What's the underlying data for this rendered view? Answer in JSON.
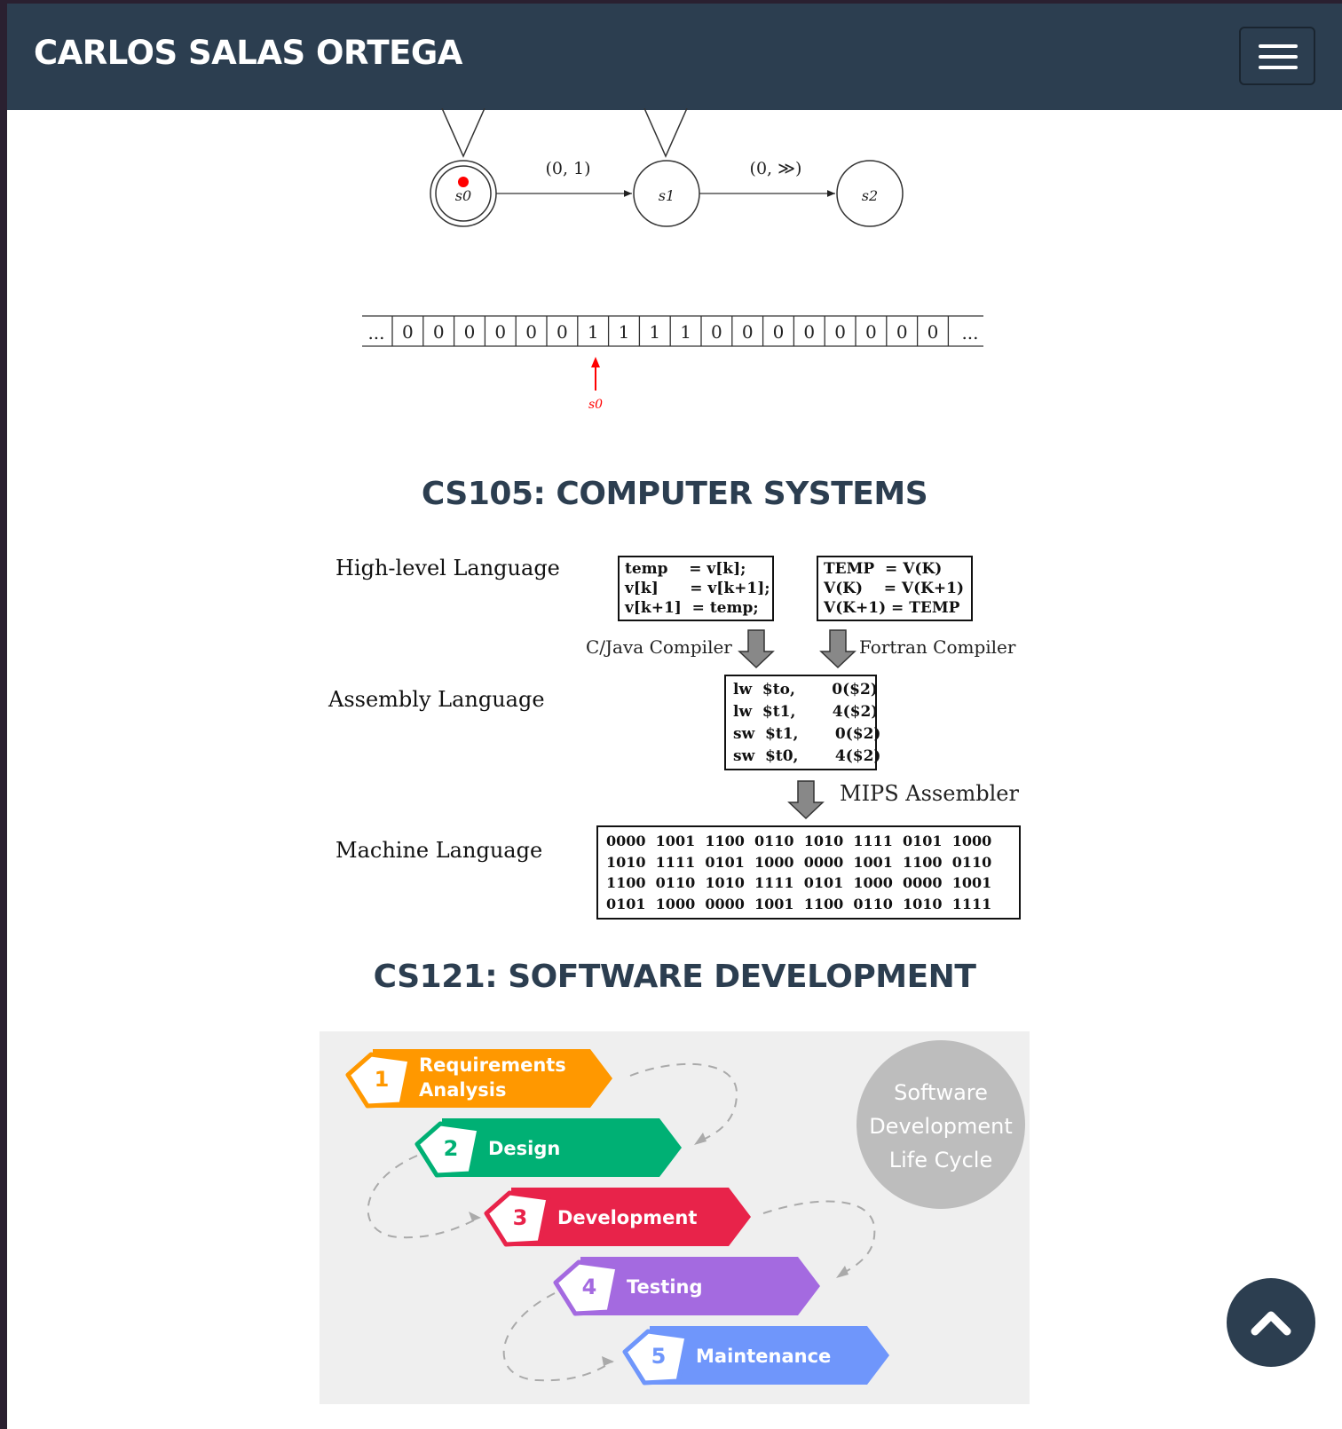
{
  "navbar": {
    "brand": "CARLOS SALAS ORTEGA",
    "menu_icon": "hamburger-menu-icon"
  },
  "automaton": {
    "states": [
      "s0",
      "s1",
      "s2"
    ],
    "edge_labels": [
      "(0, 1)",
      "(0, ≫)"
    ],
    "head_color": "#ff0000"
  },
  "tape": {
    "ellipsis": "...",
    "cells": [
      "0",
      "0",
      "0",
      "0",
      "0",
      "0",
      "1",
      "1",
      "1",
      "1",
      "0",
      "0",
      "0",
      "0",
      "0",
      "0",
      "0",
      "0"
    ],
    "head_label": "s0"
  },
  "cs105": {
    "title": "CS105: COMPUTER SYSTEMS",
    "levels": {
      "high": "High-level Language",
      "assembly": "Assembly Language",
      "machine": "Machine Language"
    },
    "c_code": [
      "temp    = v[k];",
      "v[k]      = v[k+1];",
      "v[k+1]  = temp;"
    ],
    "fortran_code": [
      "TEMP  = V(K)",
      "V(K)    = V(K+1)",
      "V(K+1) = TEMP"
    ],
    "c_compiler": "C/Java Compiler",
    "fortran_compiler": "Fortran Compiler",
    "asm_code": [
      "lw  $to,       0($2)",
      "lw  $t1,       4($2)",
      "sw  $t1,       0($2)",
      "sw  $t0,       4($2)"
    ],
    "assembler": "MIPS Assembler",
    "machine_code": [
      "0000  1001  1100  0110  1010  1111  0101  1000",
      "1010  1111  0101  1000  0000  1001  1100  0110",
      "1100  0110  1010  1111  0101  1000  0000  1001",
      "0101  1000  0000  1001  1100  0110  1010  1111"
    ]
  },
  "cs121": {
    "title": "CS121: SOFTWARE DEVELOPMENT",
    "circle_text": [
      "Software",
      "Development",
      "Life Cycle"
    ],
    "steps": [
      {
        "num": "1",
        "label_lines": [
          "Requirements",
          "Analysis"
        ],
        "color": "#ff9800"
      },
      {
        "num": "2",
        "label_lines": [
          "Design"
        ],
        "color": "#00b074"
      },
      {
        "num": "3",
        "label_lines": [
          "Development"
        ],
        "color": "#e8234a"
      },
      {
        "num": "4",
        "label_lines": [
          "Testing"
        ],
        "color": "#a46ae0"
      },
      {
        "num": "5",
        "label_lines": [
          "Maintenance"
        ],
        "color": "#6f96fb"
      }
    ]
  },
  "scroll_top_icon": "chevron-up-icon"
}
